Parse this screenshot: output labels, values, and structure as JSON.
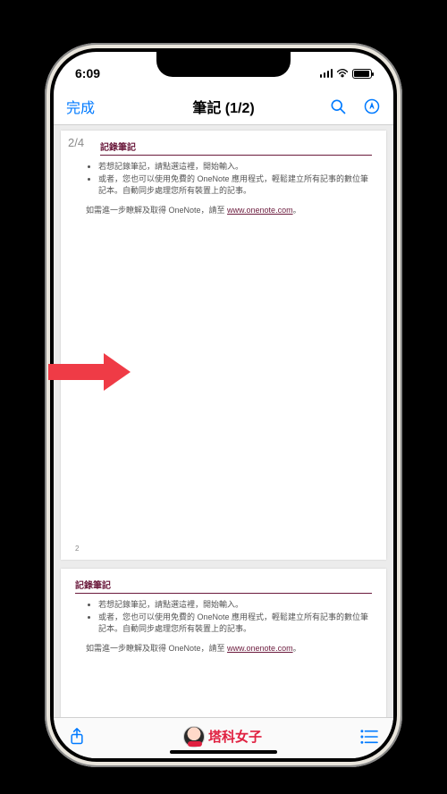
{
  "status": {
    "time": "6:09"
  },
  "nav": {
    "done": "完成",
    "title": "筆記 (1/2)"
  },
  "page_indicator": "2/4",
  "doc": {
    "heading": "記錄筆記",
    "bullet1": "若想記錄筆記，請點選這裡，開始輸入。",
    "bullet2": "或者，您也可以使用免費的 OneNote 應用程式，輕鬆建立所有記事的數位筆記本。自動同步處理您所有裝置上的記事。",
    "para_prefix": "如需進一步瞭解及取得 OneNote，請至 ",
    "link": "www.onenote.com",
    "period": "。",
    "page_num": "2"
  },
  "brand": {
    "text": "塔科女子"
  }
}
